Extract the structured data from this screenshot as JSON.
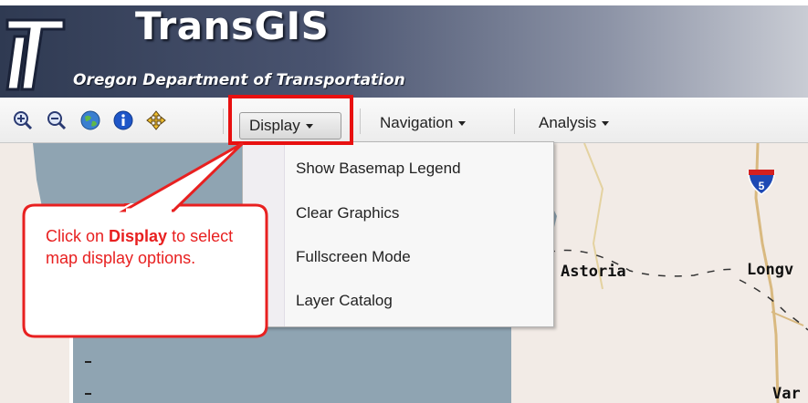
{
  "header": {
    "app_title": "TransGIS",
    "subtitle": "Oregon Department of Transportation"
  },
  "toolbar": {
    "icons": [
      "zoom-in-icon",
      "zoom-out-icon",
      "globe-icon",
      "info-icon",
      "pan-icon"
    ],
    "menus": [
      {
        "label": "Display"
      },
      {
        "label": "Navigation"
      },
      {
        "label": "Analysis"
      }
    ]
  },
  "dropdown": {
    "items": [
      {
        "label": "Show Basemap Legend"
      },
      {
        "label": "Clear Graphics"
      },
      {
        "label": "Fullscreen Mode"
      },
      {
        "label": "Layer Catalog"
      }
    ]
  },
  "callout": {
    "text_before": "Click on ",
    "text_bold": "Display",
    "text_after": " to select map display options."
  },
  "map": {
    "cities": [
      {
        "name": "Astoria"
      },
      {
        "name": "Longv"
      },
      {
        "name": "Var"
      }
    ],
    "highway_shield": "5",
    "colors": {
      "water": "#8fa4b2",
      "land": "#f2ebe6",
      "highlight": "#e81010"
    }
  }
}
